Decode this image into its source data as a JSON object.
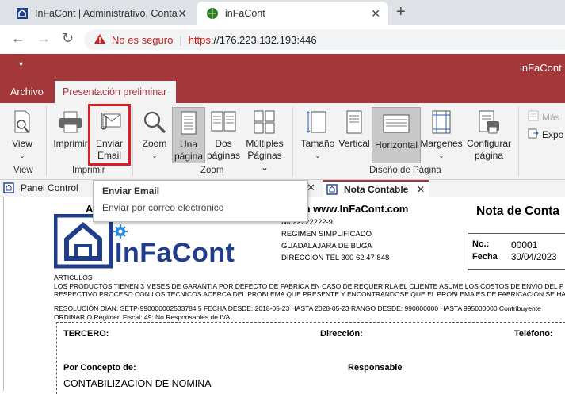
{
  "browser": {
    "tabs": [
      {
        "title": "InFaCont | Administrativo, Contab",
        "close": "✕"
      },
      {
        "title": "inFaCont",
        "close": "✕"
      }
    ],
    "new_tab": "+",
    "back": "←",
    "forward": "→",
    "reload": "↻",
    "security_text": "No es seguro",
    "url_scheme": "https",
    "url_rest": "://176.223.132.193:446"
  },
  "app": {
    "qat": "▾",
    "title": "inFaCont",
    "ribbon_tabs": [
      "Archivo",
      "Presentación preliminar"
    ],
    "buttons": {
      "view": "View",
      "print": "Imprimir",
      "email_l1": "Enviar",
      "email_l2": "Email",
      "zoom": "Zoom",
      "one_page_l1": "Una",
      "one_page_l2": "página",
      "two_pages_l1": "Dos",
      "two_pages_l2": "páginas",
      "multi_l1": "Múltiples",
      "multi_l2": "Páginas",
      "size": "Tamaño",
      "vertical": "Vertical",
      "horizontal": "Horizontal",
      "margins": "Margenes",
      "config_l1": "Configurar",
      "config_l2": "página",
      "more": "Más",
      "export": "Expo"
    },
    "groups": {
      "view": "View",
      "print": "Imprimir",
      "zoom": "Zoom",
      "page_design": "Diseño de Página"
    },
    "doc_tabs": [
      "Panel Control",
      "Nota Contable"
    ],
    "doc_tab_close": "✕",
    "tooltip": {
      "title": "Enviar Email",
      "desc": "Enviar por correo electrónico"
    }
  },
  "document": {
    "company_partial": "il.com  www.InFaCont.com",
    "company_letter": "A",
    "logo_text": "InFaCont",
    "nit": "Nit.22222222-9",
    "regimen": "REGIMEN SIMPLIFICADO",
    "city": "GUADALAJARA DE BUGA",
    "address": "DIRECCION TEL 300 62 47 848",
    "doc_title": "Nota de Conta",
    "no_label": "No.:",
    "no_value": "00001",
    "date_label": "Fecha",
    "date_value": "30/04/2023",
    "notes": [
      "ARTICULOS",
      "LOS PRODUCTOS TIENEN 3 MESES DE GARANTIA POR DEFECTO DE FABRICA EN CASO DE REQUERIRLA EL CLIENTE ASUME LOS COSTOS DE ENVIO DEL P",
      "RESPECTIVO PROCESO CON LOS TECNICOS ACERCA DEL PROBLEMA QUE PRESENTE Y ENCONTRANDOSE QUE EL PROBLEMA ES DE FABRICACION SE HAR"
    ],
    "resolution": [
      "RESOLUCIÓN DIAN: SETP-990000002533784 5 FECHA DESDE: 2018-05-23 HASTA 2028-05-23 RANGO DESDE: 990000000 HASTA 995000000 Contribuyente",
      "ORDINARIO Régimen Fiscal: 49: No Responsables de IVA"
    ],
    "tercero": "TERCERO:",
    "direccion": "Dirección:",
    "telefono": "Teléfono:",
    "concepto": "Por Concepto de:",
    "responsable": "Responsable",
    "concepto_value": "CONTABILIZACION DE NOMINA"
  }
}
